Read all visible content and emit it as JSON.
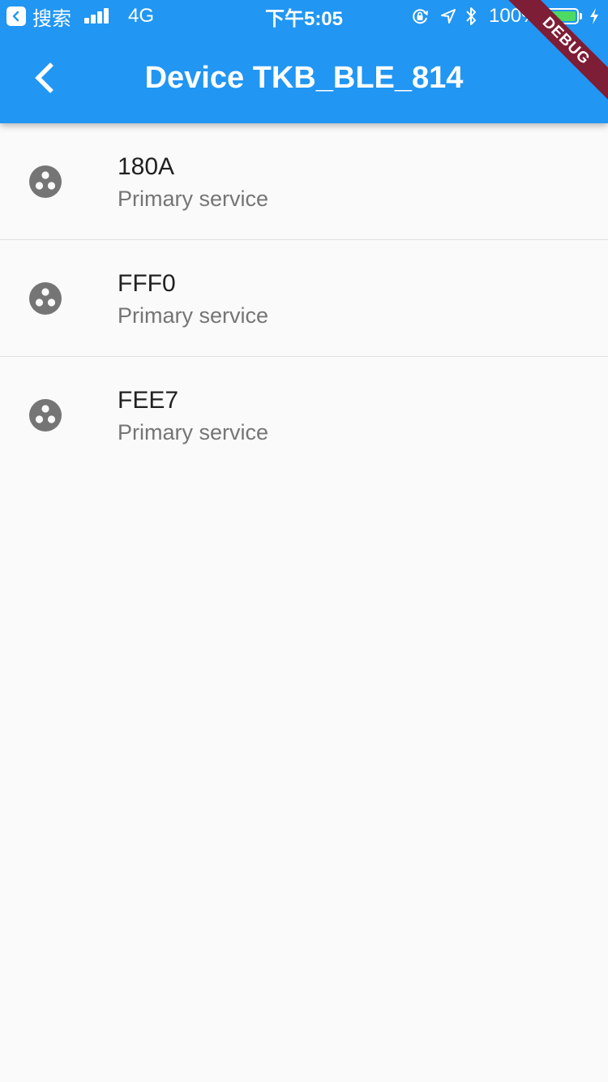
{
  "status_bar": {
    "back_app_label": "搜索",
    "network": "4G",
    "time": "下午5:05",
    "battery_percent": "100%",
    "battery_level": 1.0,
    "icons": [
      "back-app-icon",
      "signal-icon",
      "rotation-lock-icon",
      "location-icon",
      "bluetooth-icon",
      "battery-icon",
      "charging-icon"
    ]
  },
  "app_bar": {
    "title": "Device TKB_BLE_814",
    "back_icon": "chevron-left-icon",
    "debug_banner": "DEBUG"
  },
  "colors": {
    "app_bar": "#2196f3",
    "background": "#fafafa",
    "debug_banner": "#7e1d36",
    "icon": "#757575",
    "primary_text": "#212121",
    "secondary_text": "#757575",
    "battery_fill": "#4cd964"
  },
  "services": [
    {
      "uuid": "180A",
      "type": "Primary service",
      "icon": "bubble-chart-icon"
    },
    {
      "uuid": "FFF0",
      "type": "Primary service",
      "icon": "bubble-chart-icon"
    },
    {
      "uuid": "FEE7",
      "type": "Primary service",
      "icon": "bubble-chart-icon"
    }
  ]
}
